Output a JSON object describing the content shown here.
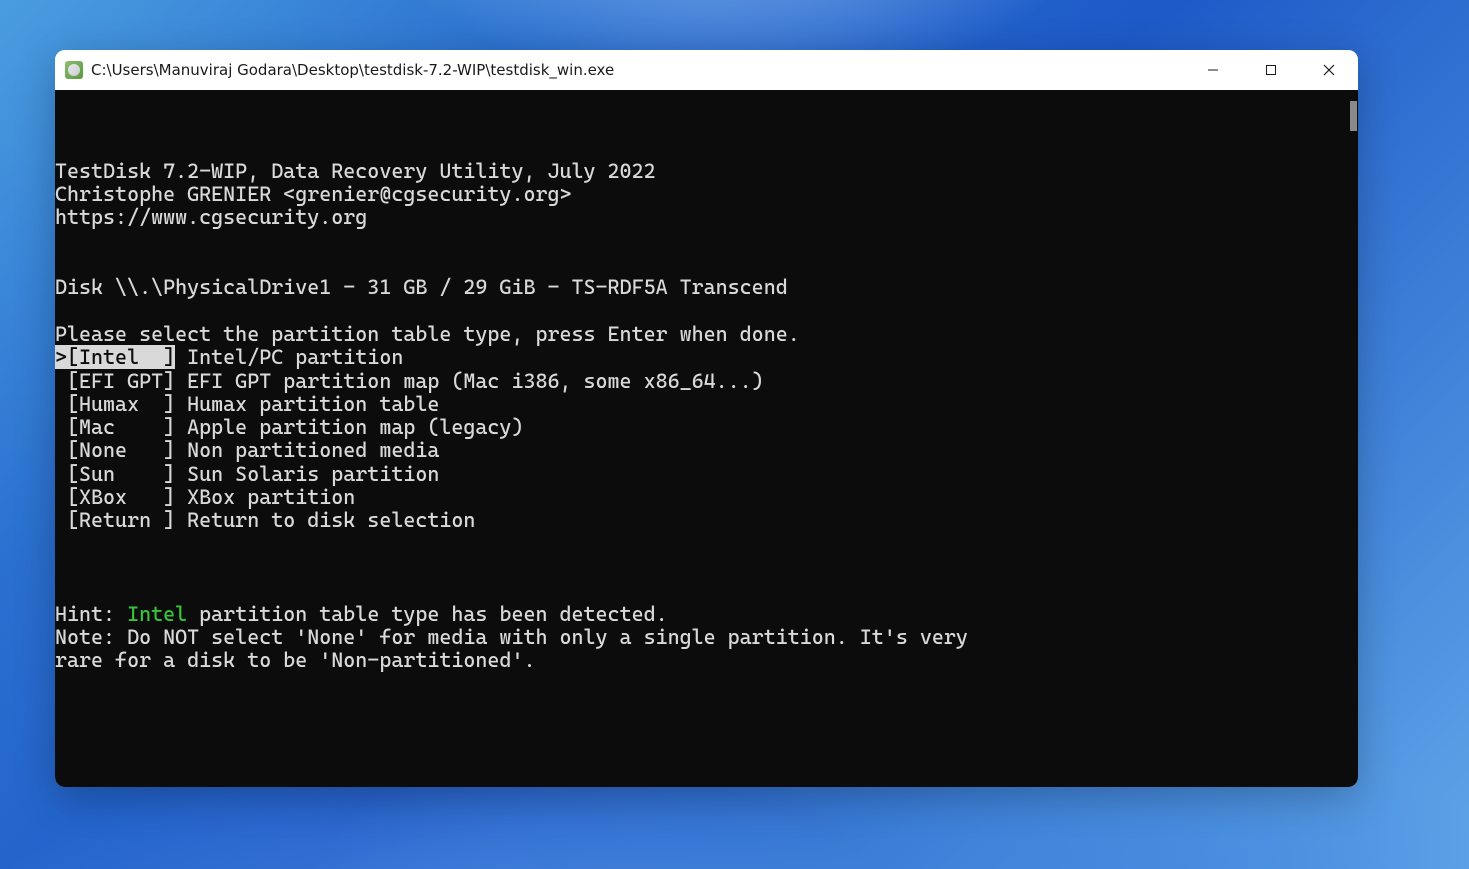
{
  "window": {
    "title": "C:\\Users\\Manuviraj Godara\\Desktop\\testdisk-7.2-WIP\\testdisk_win.exe"
  },
  "header": {
    "line1": "TestDisk 7.2-WIP, Data Recovery Utility, July 2022",
    "line2": "Christophe GRENIER <grenier@cgsecurity.org>",
    "line3": "https://www.cgsecurity.org"
  },
  "disk_line": "Disk \\\\.\\PhysicalDrive1 - 31 GB / 29 GiB - TS-RDF5A Transcend",
  "prompt": "Please select the partition table type, press Enter when done.",
  "options": [
    {
      "tag": ">[Intel  ]",
      "desc": " Intel/PC partition",
      "selected": true
    },
    {
      "tag": " [EFI GPT]",
      "desc": " EFI GPT partition map (Mac i386, some x86_64...)",
      "selected": false
    },
    {
      "tag": " [Humax  ]",
      "desc": " Humax partition table",
      "selected": false
    },
    {
      "tag": " [Mac    ]",
      "desc": " Apple partition map (legacy)",
      "selected": false
    },
    {
      "tag": " [None   ]",
      "desc": " Non partitioned media",
      "selected": false
    },
    {
      "tag": " [Sun    ]",
      "desc": " Sun Solaris partition",
      "selected": false
    },
    {
      "tag": " [XBox   ]",
      "desc": " XBox partition",
      "selected": false
    },
    {
      "tag": " [Return ]",
      "desc": " Return to disk selection",
      "selected": false
    }
  ],
  "hint": {
    "prefix": "Hint: ",
    "highlight": "Intel",
    "suffix": " partition table type has been detected."
  },
  "note_line1": "Note: Do NOT select 'None' for media with only a single partition. It's very",
  "note_line2": "rare for a disk to be 'Non-partitioned'."
}
